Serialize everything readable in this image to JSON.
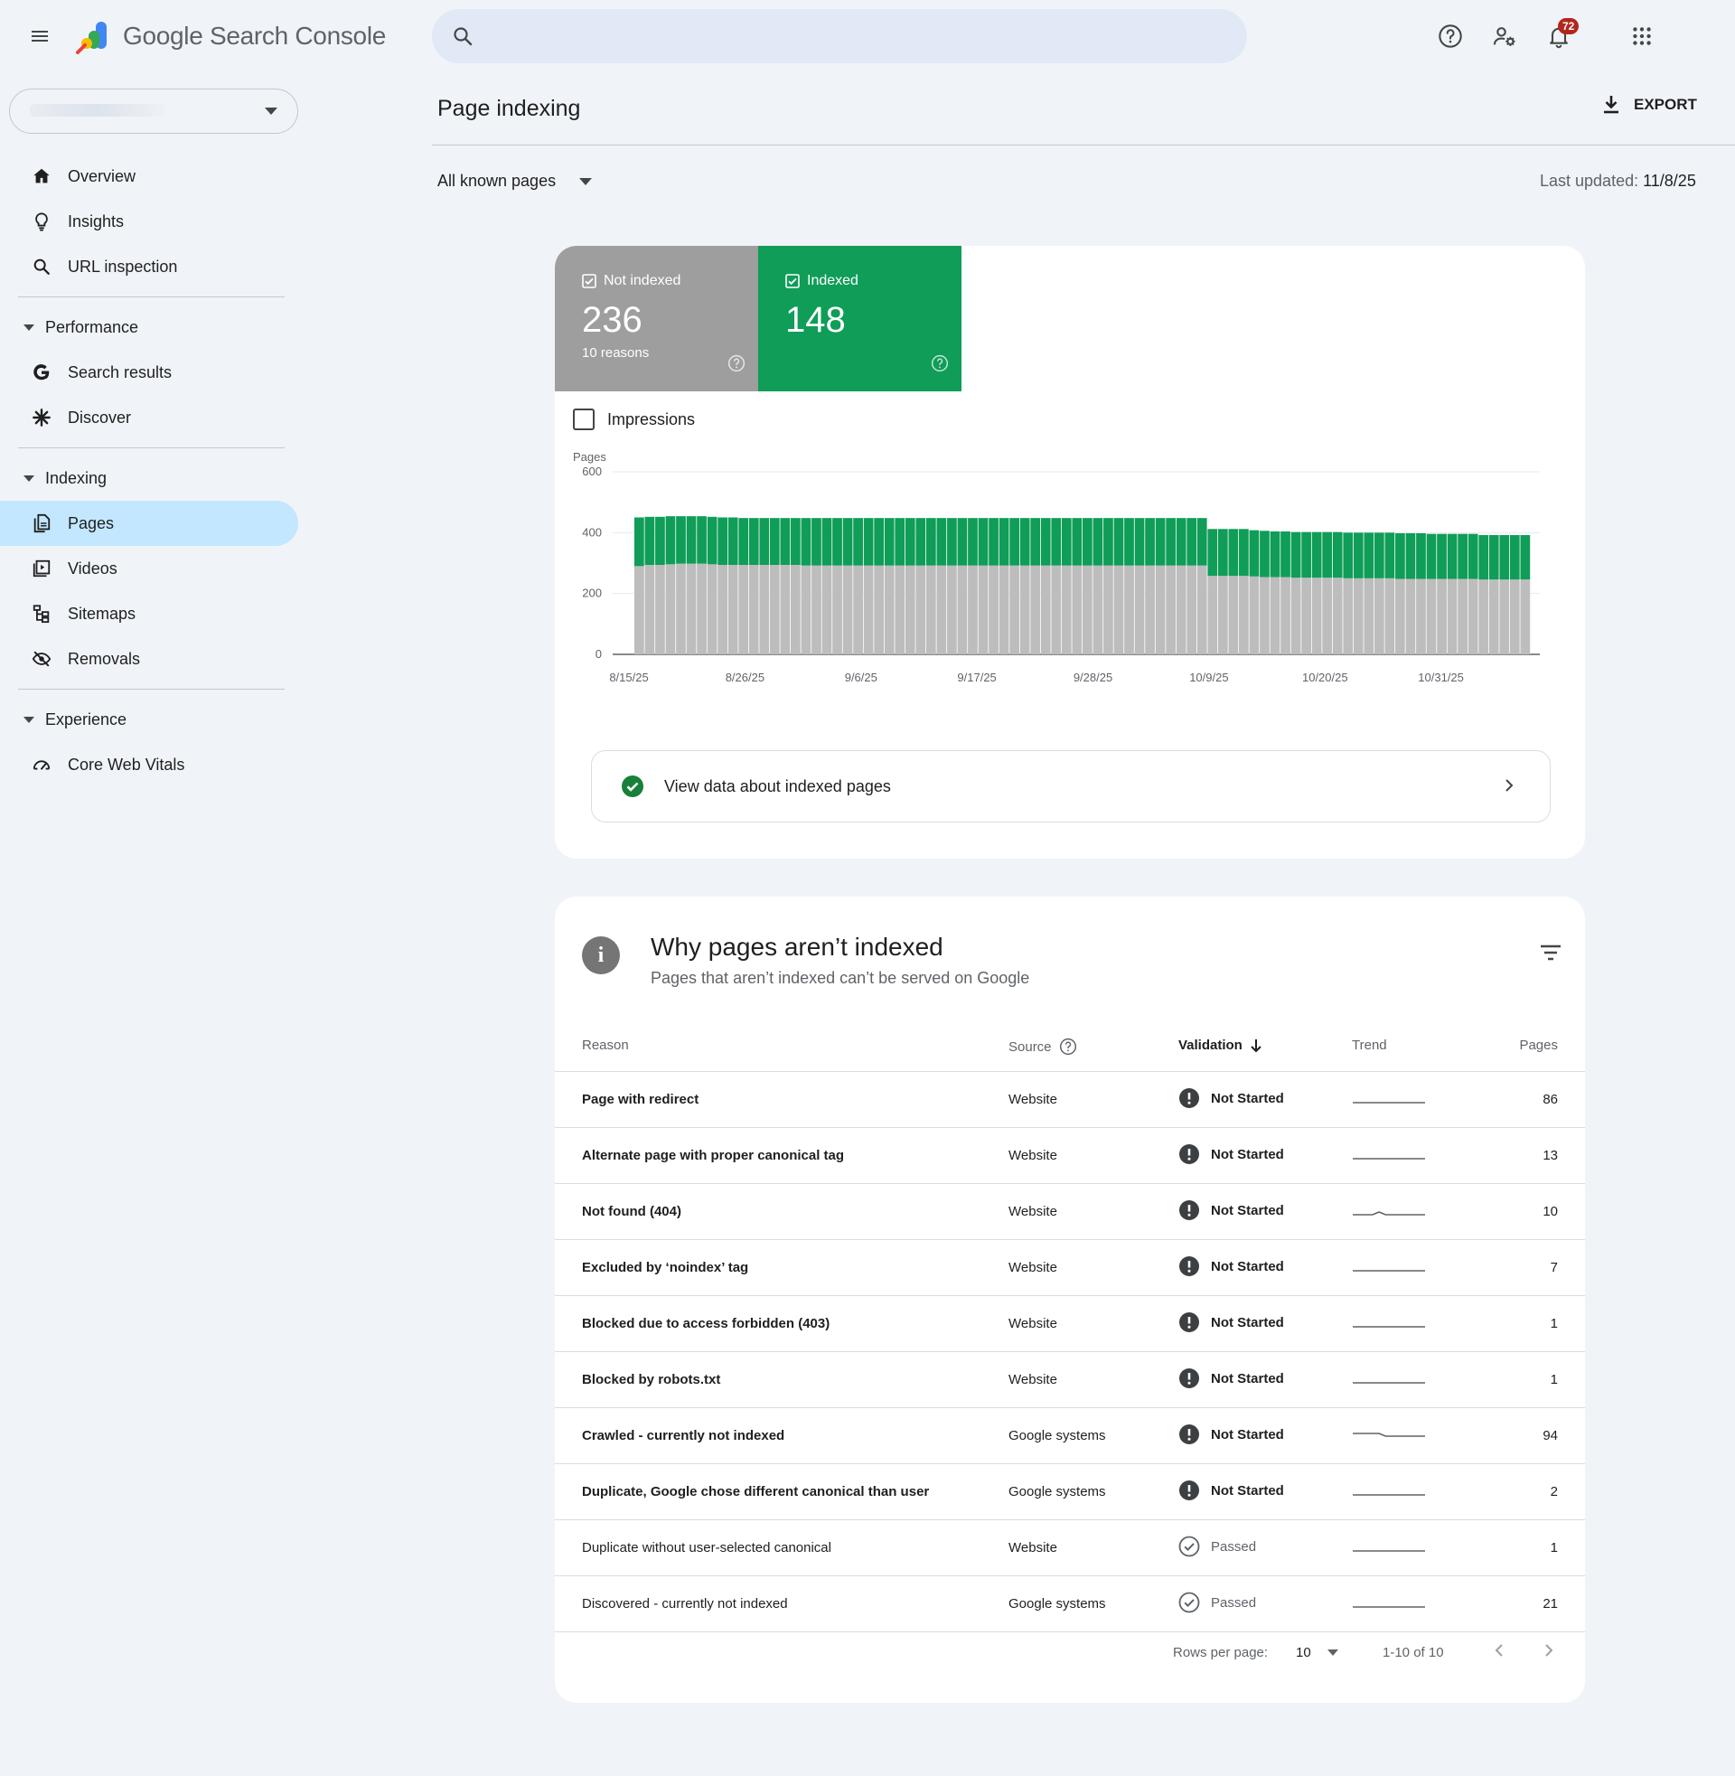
{
  "app": {
    "title_google": "Google",
    "title_product": "Search Console",
    "notifications_count": "72"
  },
  "search": {
    "placeholder": ""
  },
  "sidebar": {
    "top_items": [
      {
        "label": "Overview",
        "icon": "home-icon"
      },
      {
        "label": "Insights",
        "icon": "lightbulb-icon"
      },
      {
        "label": "URL inspection",
        "icon": "search-icon"
      }
    ],
    "sections": [
      {
        "label": "Performance",
        "items": [
          {
            "label": "Search results",
            "icon": "google-g-icon"
          },
          {
            "label": "Discover",
            "icon": "asterisk-icon"
          }
        ]
      },
      {
        "label": "Indexing",
        "items": [
          {
            "label": "Pages",
            "icon": "pages-icon",
            "active": true
          },
          {
            "label": "Videos",
            "icon": "video-icon"
          },
          {
            "label": "Sitemaps",
            "icon": "sitemap-icon"
          },
          {
            "label": "Removals",
            "icon": "eye-off-icon"
          }
        ]
      },
      {
        "label": "Experience",
        "items": [
          {
            "label": "Core Web Vitals",
            "icon": "gauge-icon"
          }
        ]
      }
    ]
  },
  "header": {
    "title": "Page indexing",
    "export_label": "EXPORT",
    "filter_label": "All known pages",
    "last_updated_label": "Last updated:",
    "last_updated_value": "11/8/25"
  },
  "summary": {
    "not_indexed": {
      "label": "Not indexed",
      "value": "236",
      "sub": "10 reasons",
      "color": "#9e9e9e"
    },
    "indexed": {
      "label": "Indexed",
      "value": "148",
      "color": "#0f9d58"
    },
    "impressions_label": "Impressions",
    "view_data_label": "View data about indexed pages"
  },
  "chart_data": {
    "type": "bar",
    "stacked": true,
    "ylabel": "Pages",
    "ylim": [
      0,
      600
    ],
    "yticks": [
      0,
      200,
      400,
      600
    ],
    "xtick_labels": [
      "8/15/25",
      "8/26/25",
      "9/6/25",
      "9/17/25",
      "9/28/25",
      "10/9/25",
      "10/20/25",
      "10/31/25"
    ],
    "x_start": "8/15/25",
    "x_end": "11/8/25",
    "series": [
      {
        "name": "Not indexed",
        "color": "#bdbdbd",
        "values": [
          290,
          294,
          294,
          296,
          298,
          298,
          298,
          296,
          294,
          294,
          294,
          294,
          294,
          294,
          294,
          294,
          292,
          292,
          292,
          292,
          292,
          292,
          292,
          292,
          292,
          292,
          292,
          292,
          292,
          292,
          292,
          292,
          292,
          292,
          292,
          292,
          292,
          292,
          292,
          292,
          292,
          292,
          292,
          292,
          292,
          292,
          292,
          292,
          292,
          292,
          292,
          292,
          292,
          292,
          292,
          258,
          258,
          258,
          258,
          256,
          254,
          254,
          254,
          252,
          252,
          252,
          252,
          252,
          250,
          250,
          250,
          250,
          250,
          248,
          248,
          248,
          248,
          248,
          248,
          248,
          248,
          246,
          246,
          246,
          246,
          246
        ]
      },
      {
        "name": "Indexed",
        "color": "#0f9d58",
        "values": [
          160,
          158,
          158,
          158,
          156,
          156,
          156,
          156,
          156,
          156,
          154,
          154,
          154,
          154,
          154,
          154,
          156,
          156,
          156,
          156,
          156,
          156,
          156,
          156,
          156,
          156,
          156,
          156,
          156,
          156,
          156,
          156,
          156,
          156,
          156,
          156,
          156,
          156,
          156,
          156,
          156,
          156,
          156,
          156,
          156,
          156,
          156,
          156,
          156,
          156,
          156,
          156,
          156,
          156,
          156,
          154,
          154,
          154,
          154,
          152,
          152,
          150,
          150,
          150,
          150,
          150,
          150,
          150,
          150,
          150,
          150,
          150,
          150,
          150,
          150,
          150,
          148,
          148,
          148,
          148,
          148,
          146,
          146,
          146,
          146,
          146
        ]
      }
    ]
  },
  "table": {
    "title": "Why pages aren’t indexed",
    "subtitle": "Pages that aren’t indexed can’t be served on Google",
    "columns": {
      "reason": "Reason",
      "source": "Source",
      "validation": "Validation",
      "trend": "Trend",
      "pages": "Pages"
    },
    "rows": [
      {
        "reason": "Page with redirect",
        "source": "Website",
        "validation": "Not Started",
        "status": "not-started",
        "pages": "86",
        "trend": [
          0,
          0,
          0,
          0,
          0,
          0,
          0,
          0,
          0,
          0,
          0,
          0
        ]
      },
      {
        "reason": "Alternate page with proper canonical tag",
        "source": "Website",
        "validation": "Not Started",
        "status": "not-started",
        "pages": "13",
        "trend": [
          0,
          0,
          0,
          0,
          0,
          0,
          0,
          0,
          0,
          0,
          0,
          0
        ]
      },
      {
        "reason": "Not found (404)",
        "source": "Website",
        "validation": "Not Started",
        "status": "not-started",
        "pages": "10",
        "trend": [
          0,
          0,
          0,
          0,
          1,
          0,
          0,
          0,
          0,
          0,
          0,
          0
        ]
      },
      {
        "reason": "Excluded by ‘noindex’ tag",
        "source": "Website",
        "validation": "Not Started",
        "status": "not-started",
        "pages": "7",
        "trend": [
          0,
          0,
          0,
          0,
          0,
          0,
          0,
          0,
          0,
          0,
          0,
          0
        ]
      },
      {
        "reason": "Blocked due to access forbidden (403)",
        "source": "Website",
        "validation": "Not Started",
        "status": "not-started",
        "pages": "1",
        "trend": [
          0,
          0,
          0,
          0,
          0,
          0,
          0,
          0,
          0,
          0,
          0,
          0
        ]
      },
      {
        "reason": "Blocked by robots.txt",
        "source": "Website",
        "validation": "Not Started",
        "status": "not-started",
        "pages": "1",
        "trend": [
          0,
          0,
          0,
          0,
          0,
          0,
          0,
          0,
          0,
          0,
          0,
          0
        ]
      },
      {
        "reason": "Crawled - currently not indexed",
        "source": "Google systems",
        "validation": "Not Started",
        "status": "not-started",
        "pages": "94",
        "trend": [
          2,
          2,
          2,
          2,
          2,
          1,
          1,
          1,
          1,
          1,
          1,
          1
        ]
      },
      {
        "reason": "Duplicate, Google chose different canonical than user",
        "source": "Google systems",
        "validation": "Not Started",
        "status": "not-started",
        "pages": "2",
        "trend": [
          0,
          0,
          0,
          0,
          0,
          0,
          0,
          0,
          0,
          0,
          0,
          0
        ]
      },
      {
        "reason": "Duplicate without user-selected canonical",
        "source": "Website",
        "validation": "Passed",
        "status": "passed",
        "pages": "1",
        "trend": [
          0,
          0,
          0,
          0,
          0,
          0,
          0,
          0,
          0,
          0,
          0,
          0
        ]
      },
      {
        "reason": "Discovered - currently not indexed",
        "source": "Google systems",
        "validation": "Passed",
        "status": "passed",
        "pages": "21",
        "trend": [
          0,
          0,
          0,
          0,
          0,
          0,
          0,
          0,
          0,
          0,
          0,
          0
        ]
      }
    ],
    "pagination": {
      "rows_per_page_label": "Rows per page:",
      "rows_per_page_value": "10",
      "range": "1-10 of 10"
    }
  }
}
